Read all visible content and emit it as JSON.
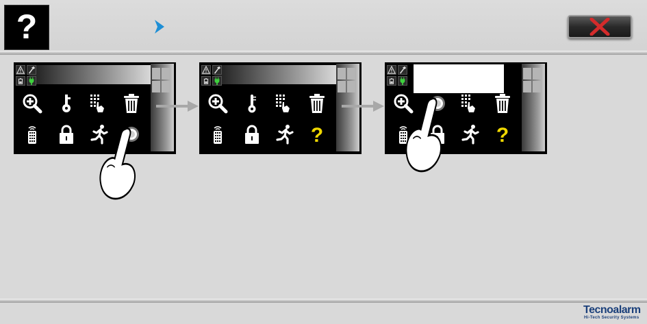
{
  "header": {
    "help_label": "?",
    "close_icon": "close-x-icon",
    "breadcrumb_icon": "chevron-right-icon",
    "colors": {
      "close_x": "#d42b2b",
      "breadcrumb": "#1e8fd6",
      "help_bg": "#000000"
    }
  },
  "steps": [
    {
      "icons": [
        "zoom-in-icon",
        "key-icon",
        "keypad-touch-icon",
        "trash-icon",
        "remote-icon",
        "lock-icon",
        "running-man-icon",
        "touch-icon"
      ],
      "action": "tap bottom-right key"
    },
    {
      "icons": [
        "zoom-in-icon",
        "thermometer-icon",
        "keypad-touch-icon",
        "trash-icon",
        "remote-icon",
        "lock-icon",
        "running-man-icon",
        "help-question-icon"
      ]
    },
    {
      "icons": [
        "zoom-in-icon",
        "touch-icon",
        "keypad-touch-icon",
        "trash-icon",
        "remote-icon",
        "lock-icon",
        "running-man-icon",
        "help-question-icon"
      ],
      "action": "tap second key"
    }
  ],
  "help_key_color": "#f0d800",
  "status_icons": [
    "warning-icon",
    "hammer-icon",
    "battery-icon",
    "plug-icon"
  ],
  "footer": {
    "logo_text": "Tecnoalarm",
    "logo_tagline": "Hi-Tech Security Systems"
  }
}
